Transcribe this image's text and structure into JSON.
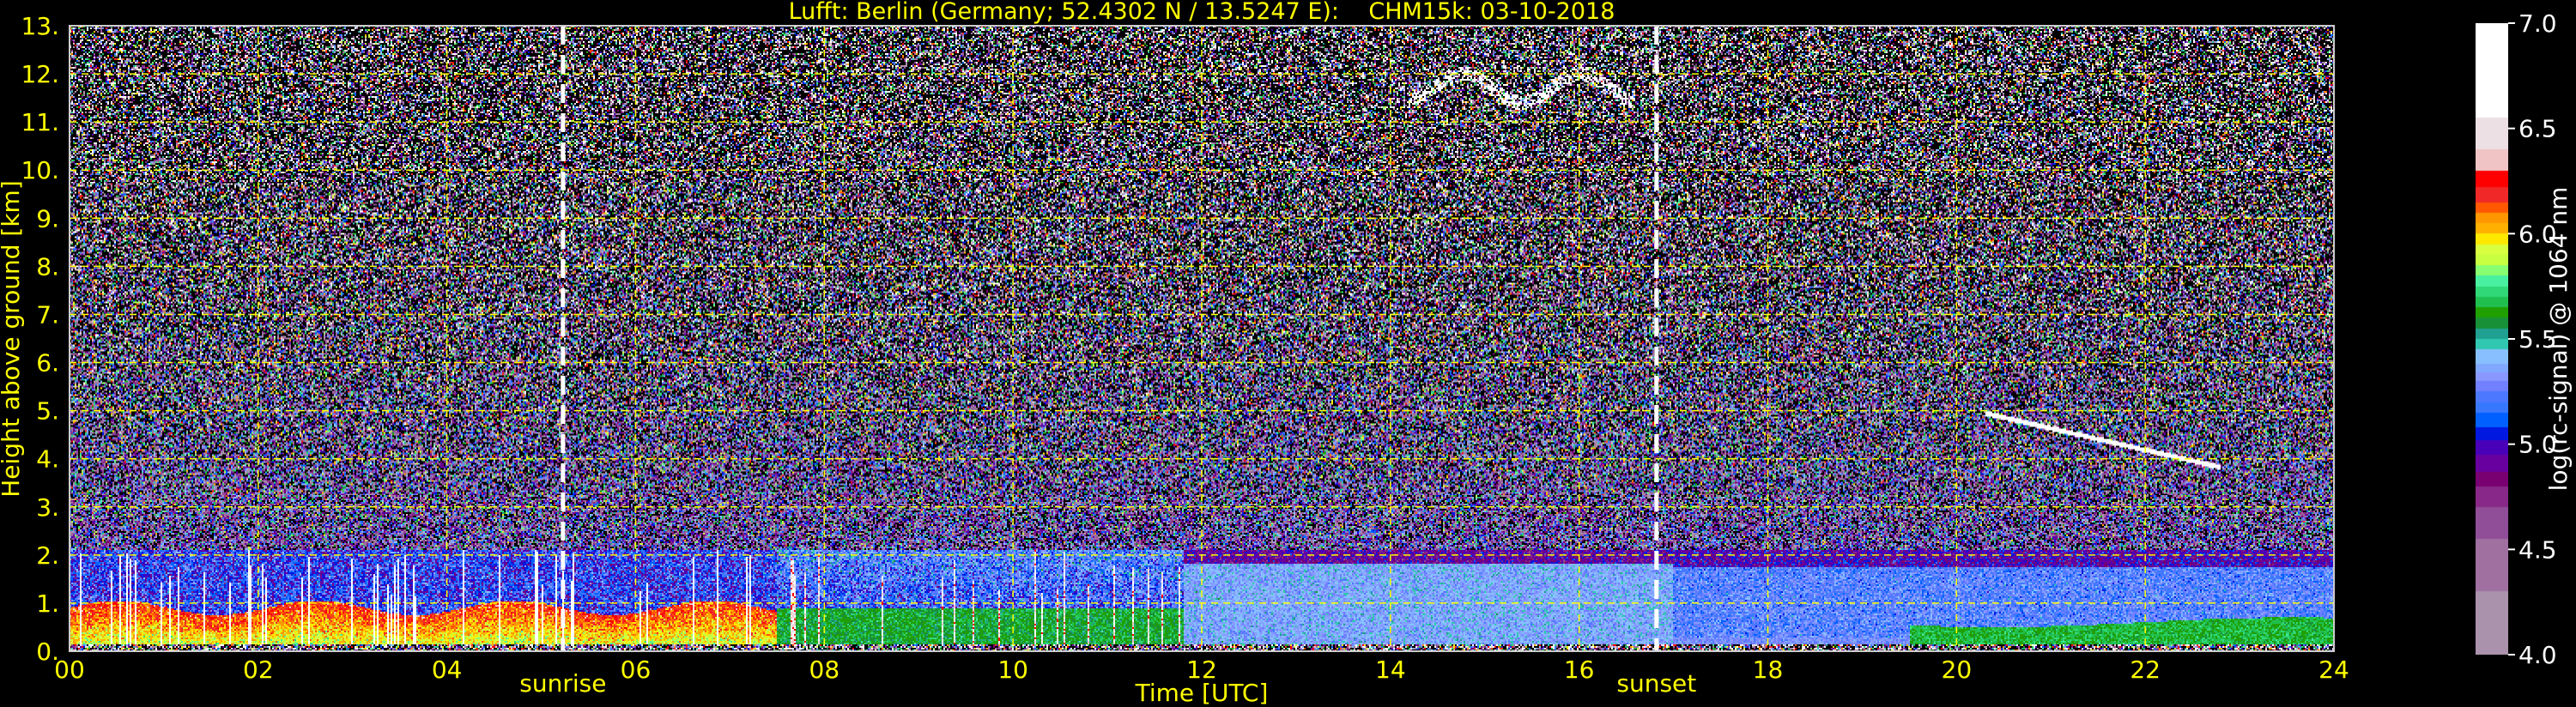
{
  "chart_data": {
    "type": "heatmap",
    "title": "Lufft: Berlin (Germany; 52.4302 N / 13.5247 E):    CHM15k: 03-10-2018",
    "xlabel": "Time [UTC]",
    "ylabel": "Height above ground [km]",
    "xlim": [
      0,
      24
    ],
    "ylim": [
      0,
      13
    ],
    "xticks": [
      "00",
      "02",
      "04",
      "06",
      "08",
      "10",
      "12",
      "14",
      "16",
      "18",
      "20",
      "22",
      "24"
    ],
    "yticks": [
      "0.",
      "1.",
      "2.",
      "3.",
      "4.",
      "5.",
      "6.",
      "7.",
      "8.",
      "9.",
      "10.",
      "11.",
      "12.",
      "13."
    ],
    "grid": true,
    "grid_color": "#ffff00",
    "text_color": "#ffff00",
    "annotations": [
      {
        "label": "sunrise",
        "time_h": 5.23,
        "line": "dashed",
        "color": "#ffffff"
      },
      {
        "label": "sunset",
        "time_h": 16.82,
        "line": "dashed",
        "color": "#ffffff"
      }
    ],
    "colorbar": {
      "label": "log(rc-signal) @ 1064 nm",
      "range": [
        4.0,
        7.0
      ],
      "ticks": [
        "4.0",
        "4.5",
        "5.0",
        "5.5",
        "6.0",
        "6.5",
        "7.0"
      ],
      "bounds": [
        4.0,
        4.3,
        4.55,
        4.7,
        4.8,
        4.87,
        4.95,
        5.02,
        5.08,
        5.15,
        5.2,
        5.25,
        5.3,
        5.34,
        5.38,
        5.45,
        5.5,
        5.55,
        5.6,
        5.65,
        5.7,
        5.75,
        5.8,
        5.85,
        5.9,
        5.95,
        6.0,
        6.05,
        6.1,
        6.15,
        6.22,
        6.3,
        6.4,
        6.55,
        7.0
      ],
      "colors": [
        "#aa92ac",
        "#a070a0",
        "#904e98",
        "#882888",
        "#780070",
        "#6800a0",
        "#4800b8",
        "#0018e0",
        "#0060ff",
        "#3878ff",
        "#4c78ff",
        "#7080ff",
        "#8898ff",
        "#80a8ff",
        "#88c0ff",
        "#30c8b0",
        "#20a090",
        "#189038",
        "#20a000",
        "#20c050",
        "#30d878",
        "#48f0a0",
        "#88ff70",
        "#c8ff40",
        "#d8ff40",
        "#ffe800",
        "#ffb000",
        "#ff9800",
        "#ff5800",
        "#f02828",
        "#ff0000",
        "#f0c4c4",
        "#ece0e4",
        "#ffffff"
      ]
    },
    "features": [
      {
        "description_label": "",
        "layer": "boundary layer",
        "time_range_h": [
          0,
          7.5
        ],
        "height_km": [
          0,
          1.0
        ],
        "value": 5.95
      },
      {
        "layer": "boundary layer",
        "time_range_h": [
          7.5,
          11.8
        ],
        "height_km": [
          0,
          0.9
        ],
        "value": 5.62
      },
      {
        "layer": "boundary layer",
        "time_range_h": [
          11.8,
          17
        ],
        "height_km": [
          0,
          1.8
        ],
        "value": 5.35
      },
      {
        "layer": "boundary layer",
        "time_range_h": [
          19.5,
          24
        ],
        "height_km": [
          0,
          0.6
        ],
        "value": 5.65
      },
      {
        "layer": "cloud",
        "time_range_h": [
          14.2,
          16.6
        ],
        "height_km": [
          11.3,
          12.1
        ],
        "value": 6.8
      },
      {
        "layer": "cloud",
        "time_range_h": [
          20.3,
          22.8
        ],
        "height_km": [
          3.8,
          5.0
        ],
        "value": 6.8
      }
    ]
  }
}
